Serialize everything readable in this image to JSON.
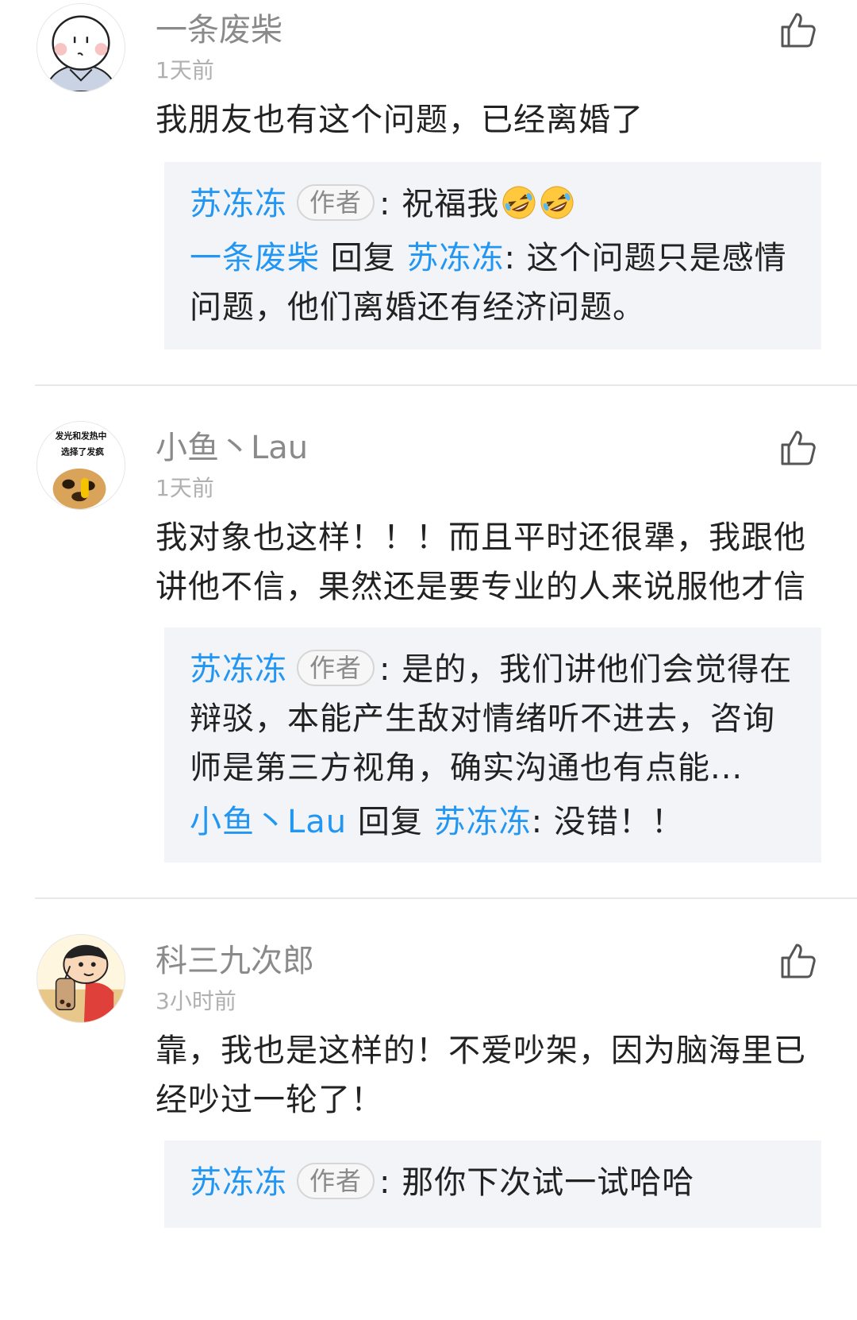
{
  "comments": [
    {
      "username": "一条废柴",
      "time": "1天前",
      "content": "我朋友也有这个问题，已经离婚了",
      "replies": [
        {
          "author": "苏冻冻",
          "badge": "作者",
          "text": ": 祝福我",
          "emoji": [
            "rofl-emoji",
            "rofl-emoji"
          ]
        },
        {
          "author": "一条废柴",
          "verb": " 回复 ",
          "target": "苏冻冻",
          "text": ": 这个问题只是感情问题，他们离婚还有经济问题。"
        }
      ]
    },
    {
      "username": "小鱼丶Lau",
      "time": "1天前",
      "avatar_text": [
        "发光和发热中",
        "选择了发疯"
      ],
      "content": "我对象也这样！！！而且平时还很犟，我跟他讲他不信，果然还是要专业的人来说服他才信",
      "replies": [
        {
          "author": "苏冻冻",
          "badge": "作者",
          "text": ": 是的，我们讲他们会觉得在辩驳，本能产生敌对情绪听不进去，咨询师是第三方视角，确实沟通也有点能..."
        },
        {
          "author": "小鱼丶Lau",
          "verb": " 回复 ",
          "target": "苏冻冻",
          "text": ": 没错！！"
        }
      ]
    },
    {
      "username": "科三九次郎",
      "time": "3小时前",
      "content": "靠，我也是这样的！不爱吵架，因为脑海里已经吵过一轮了！",
      "replies": [
        {
          "author": "苏冻冻",
          "badge": "作者",
          "text": ": 那你下次试一试哈哈"
        }
      ]
    }
  ],
  "colors": {
    "link": "#2196f3",
    "reply_bg": "#f3f4f7",
    "username": "#8a8a8a",
    "time": "#b0b0b0"
  }
}
